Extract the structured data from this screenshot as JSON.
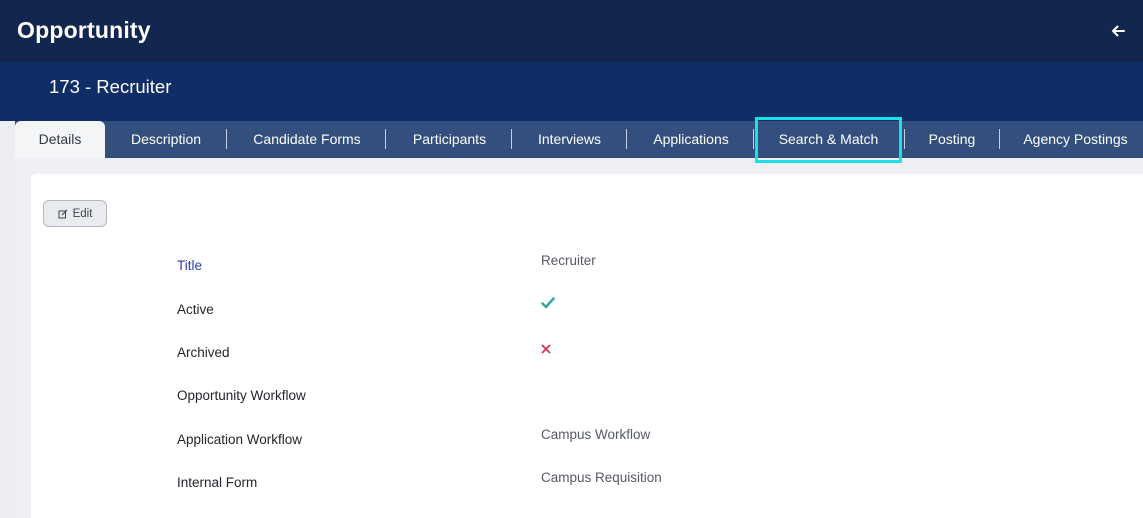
{
  "header": {
    "title": "Opportunity",
    "back_icon": "arrow-left-icon"
  },
  "record": {
    "title": "173 - Recruiter"
  },
  "tabs": [
    {
      "label": "Details",
      "active": true
    },
    {
      "label": "Description"
    },
    {
      "label": "Candidate Forms"
    },
    {
      "label": "Participants"
    },
    {
      "label": "Interviews"
    },
    {
      "label": "Applications"
    },
    {
      "label": "Search & Match",
      "highlighted": true
    },
    {
      "label": "Posting"
    },
    {
      "label": "Agency Postings"
    }
  ],
  "toolbar": {
    "edit_label": "Edit",
    "edit_icon": "edit-icon"
  },
  "fields": [
    {
      "label": "Title",
      "value": "Recruiter"
    },
    {
      "label": "Active",
      "value_icon": "check-icon"
    },
    {
      "label": "Archived",
      "value_icon": "x-icon"
    },
    {
      "label": "Opportunity Workflow",
      "value": ""
    },
    {
      "label": "Application Workflow",
      "value": "Campus Workflow"
    },
    {
      "label": "Internal Form",
      "value": "Campus Requisition"
    }
  ],
  "colors": {
    "header_bg": "#13264f",
    "subheader_bg": "#0f2d66",
    "tabbar_bg": "#334f7d",
    "highlight": "#18e2e8",
    "link_label": "#2d3fb8",
    "check": "#3aa6a6",
    "cross": "#d0344e"
  }
}
